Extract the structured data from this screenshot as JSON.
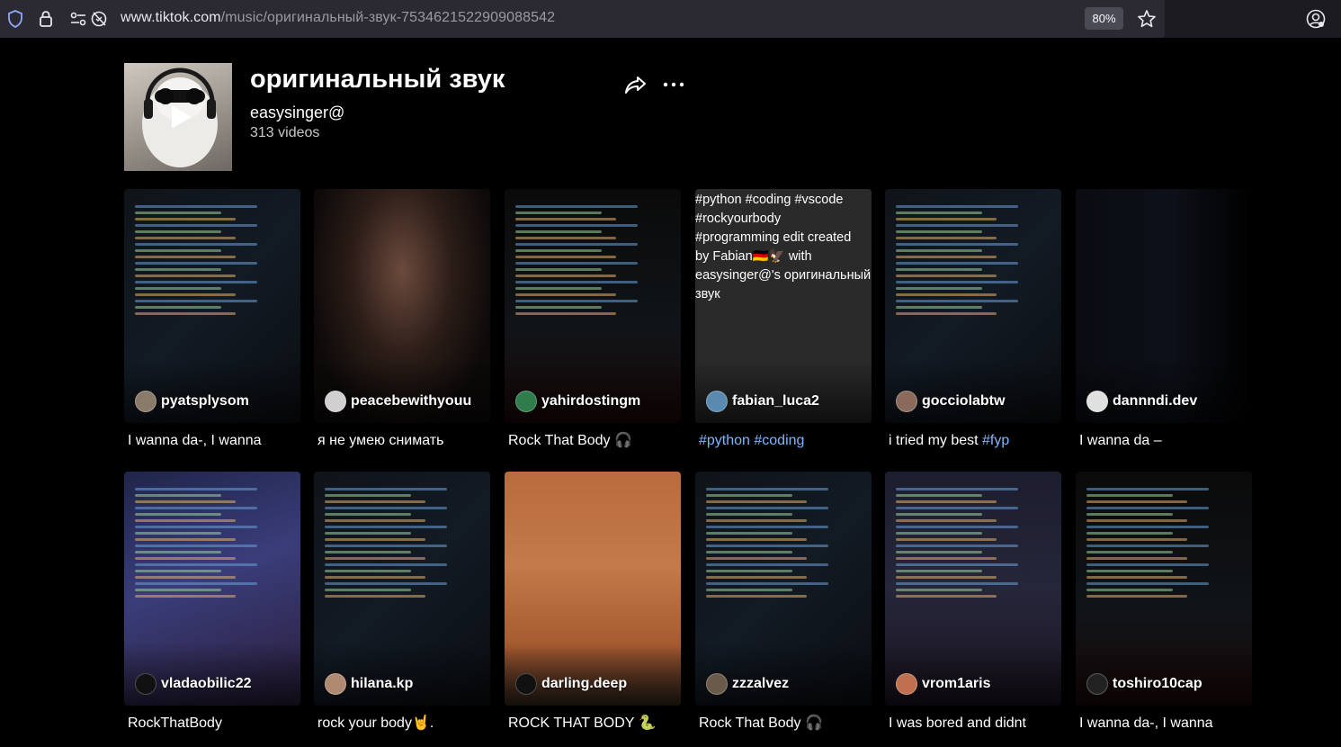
{
  "browser": {
    "url_host": "www.tiktok.com",
    "url_path": "/music/оригинальный-звук-7534621522909088542",
    "zoom": "80%",
    "icons": [
      "shield-icon",
      "lock-icon",
      "permissions-icon",
      "star-icon",
      "account-icon"
    ]
  },
  "music": {
    "title": "оригинальный звук",
    "author": "easysinger@",
    "video_count": "313 videos",
    "icons": [
      "play-icon",
      "share-icon",
      "more-icon"
    ]
  },
  "videos": [
    {
      "username": "pyatsplysom",
      "caption": "I wanna da-, I wanna",
      "caption_tags": "",
      "overlay": [],
      "avatar_color": "#8a7a6a"
    },
    {
      "username": "peacebewithyouu",
      "caption": "я не умею снимать",
      "caption_tags": "",
      "overlay": [],
      "avatar_color": "#d0d0d0"
    },
    {
      "username": "yahirdostingm",
      "caption": "Rock That Body 🎧",
      "caption_tags": "",
      "overlay": [],
      "avatar_color": "#2e7d4a"
    },
    {
      "username": "fabian_luca2",
      "caption": "",
      "caption_tags": "#python #coding",
      "overlay": [
        "#python #coding #vscode",
        "#rockyourbody",
        "#programming edit created",
        "by Fabian🇩🇪🦅 with",
        "easysinger@'s оригинальный",
        "звук"
      ],
      "avatar_color": "#5a8ab0"
    },
    {
      "username": "gocciolabtw",
      "caption": "i tried my best ",
      "caption_tags": "#fyp",
      "overlay": [],
      "avatar_color": "#8a6a5a"
    },
    {
      "username": "dannndi.dev",
      "caption": "I wanna da –",
      "caption_tags": "",
      "overlay": [],
      "avatar_color": "#e0e0e0"
    },
    {
      "username": "vladaobilic22",
      "caption": "RockThatBody",
      "caption_tags": "",
      "overlay": [],
      "avatar_color": "#111111"
    },
    {
      "username": "hilana.kp",
      "caption": "rock your body🤘.",
      "caption_tags": "",
      "overlay": [],
      "avatar_color": "#b08a70"
    },
    {
      "username": "darling.deep",
      "caption": "ROCK THAT BODY 🐍",
      "caption_tags": "",
      "overlay": [],
      "avatar_color": "#111111"
    },
    {
      "username": "zzzalvez",
      "caption": "Rock That Body 🎧",
      "caption_tags": "",
      "overlay": [],
      "avatar_color": "#6a5a4a"
    },
    {
      "username": "vrom1aris",
      "caption": "I was bored and didnt",
      "caption_tags": "",
      "overlay": [],
      "avatar_color": "#c07050"
    },
    {
      "username": "toshiro10cap",
      "caption": "I wanna da-, I wanna",
      "caption_tags": "",
      "overlay": [],
      "avatar_color": "#222222"
    }
  ],
  "colors": {
    "background": "#000000",
    "hashtag": "#7fb6ff",
    "urlbar": "#2b2a33"
  }
}
